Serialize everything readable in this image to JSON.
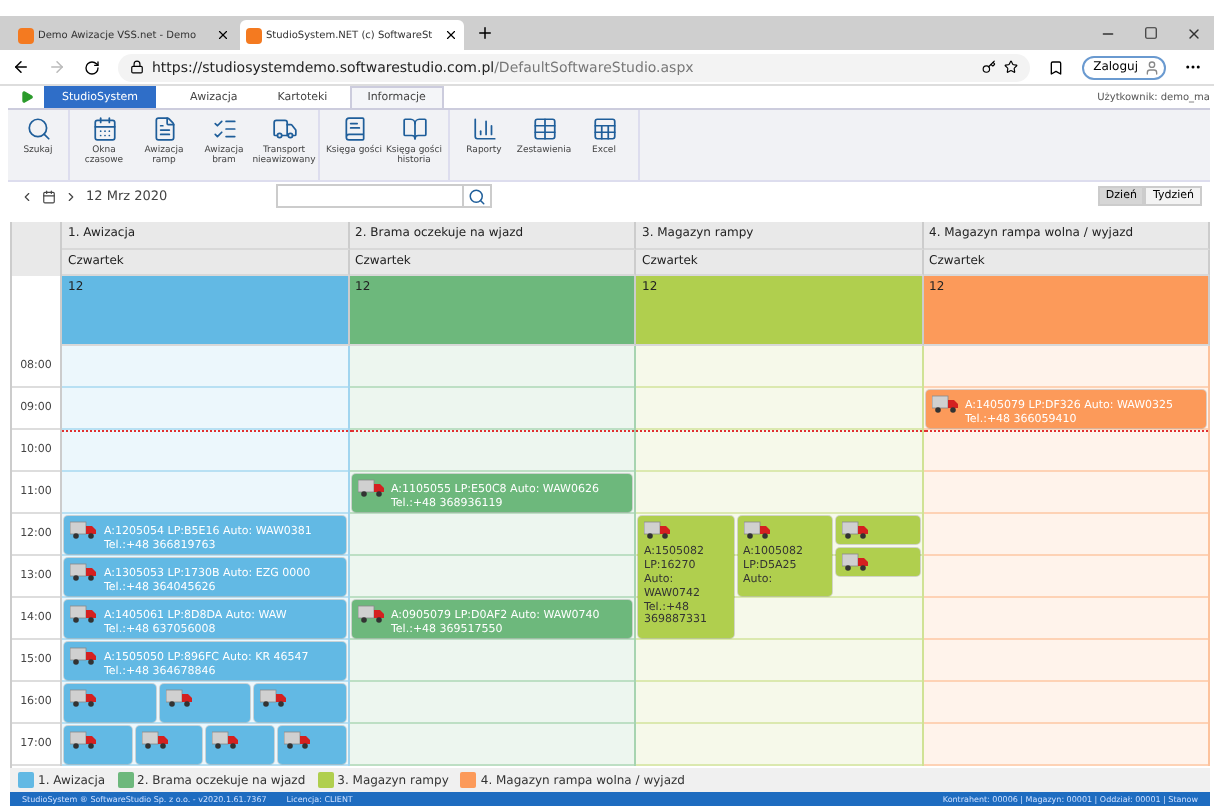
{
  "browser": {
    "tabs": [
      {
        "title": "Demo Awizacje VSS.net - Demo",
        "selected": false
      },
      {
        "title": "StudioSystem.NET (c) SoftwareSt",
        "selected": true
      }
    ],
    "url": {
      "host": "https://studiosystemdemo.softwarestudio.com.pl",
      "path": "/DefaultSoftwareStudio.aspx"
    },
    "profile_button": "Zaloguj"
  },
  "app": {
    "menu": [
      {
        "label": "StudioSystem",
        "kind": "app",
        "selected": false
      },
      {
        "label": "Awizacja",
        "kind": "tab",
        "selected": false
      },
      {
        "label": "Kartoteki",
        "kind": "tab",
        "selected": false
      },
      {
        "label": "Informacje",
        "kind": "tab",
        "selected": true
      }
    ],
    "user": "Użytkownik: demo_ma",
    "ribbon": [
      [
        "Szukaj"
      ],
      [
        "Okna czasowe",
        "Awizacja ramp",
        "Awizacja bram",
        "Transport nieawizowany"
      ],
      [
        "Księga gości",
        "Księga gości historia"
      ],
      [
        "Raporty",
        "Zestawienia",
        "Excel"
      ]
    ]
  },
  "date_nav": {
    "date": "12 Mrz 2020",
    "views": [
      {
        "label": "Dzień",
        "selected": true
      },
      {
        "label": "Tydzień",
        "selected": false
      }
    ]
  },
  "times": [
    {
      "label": "08:00",
      "now": false
    },
    {
      "label": "09:00",
      "now": false
    },
    {
      "label": "10:00",
      "now": true
    },
    {
      "label": "11:00",
      "now": false
    },
    {
      "label": "12:00",
      "now": false
    },
    {
      "label": "13:00",
      "now": false
    },
    {
      "label": "14:00",
      "now": false
    },
    {
      "label": "15:00",
      "now": false
    },
    {
      "label": "16:00",
      "now": false
    },
    {
      "label": "17:00",
      "now": false
    }
  ],
  "columns": [
    {
      "title": "1. Awizacja",
      "day": "Czwartek",
      "date": "12",
      "color": "#62b9e4",
      "cells": [
        {
          "kind": "free"
        },
        {
          "kind": "free"
        },
        {
          "kind": "free"
        },
        {
          "kind": "free"
        },
        {
          "kind": "booked",
          "lanes": [
            {
              "kind": "hour",
              "lines": [
                "A:1205054 LP:B5E16 Auto: WAW0381",
                "Tel.:+48 366819763"
              ]
            }
          ]
        },
        {
          "kind": "booked",
          "lanes": [
            {
              "kind": "hour",
              "lines": [
                "A:1305053 LP:1730B Auto: EZG 0000",
                "Tel.:+48 364045626"
              ]
            }
          ]
        },
        {
          "kind": "booked",
          "lanes": [
            {
              "kind": "hour",
              "lines": [
                "A:1405061 LP:8D8DA Auto: WAW",
                "Tel.:+48 637056008"
              ]
            }
          ]
        },
        {
          "kind": "booked",
          "lanes": [
            {
              "kind": "hour",
              "lines": [
                "A:1505050 LP:896FC Auto: KR 46547",
                "Tel.:+48 364678846"
              ]
            }
          ]
        },
        {
          "kind": "booked",
          "lanes": [
            {
              "kind": "hour"
            },
            {
              "kind": "hour"
            },
            {
              "kind": "hour"
            }
          ]
        },
        {
          "kind": "booked",
          "lanes": [
            {
              "kind": "hour"
            },
            {
              "kind": "hour"
            },
            {
              "kind": "hour"
            },
            {
              "kind": "hour"
            }
          ]
        }
      ]
    },
    {
      "title": "2. Brama oczekuje na wjazd",
      "day": "Czwartek",
      "date": "12",
      "color": "#6db87c",
      "cells": [
        {
          "kind": "free"
        },
        {
          "kind": "free"
        },
        {
          "kind": "free"
        },
        {
          "kind": "booked",
          "lanes": [
            {
              "kind": "hour",
              "lines": [
                "A:1105055 LP:E50C8 Auto: WAW0626",
                "Tel.:+48 368936119"
              ]
            }
          ]
        },
        {
          "kind": "free"
        },
        {
          "kind": "free"
        },
        {
          "kind": "booked",
          "lanes": [
            {
              "kind": "hour",
              "lines": [
                "A:0905079 LP:D0AF2 Auto: WAW0740",
                "Tel.:+48 369517550"
              ]
            }
          ]
        },
        {
          "kind": "free"
        },
        {
          "kind": "free"
        },
        {
          "kind": "free"
        }
      ]
    },
    {
      "title": "3. Magazyn rampy",
      "day": "Czwartek",
      "date": "12",
      "color": "#b0cf4e",
      "cells": [
        {
          "kind": "free"
        },
        {
          "kind": "free"
        },
        {
          "kind": "free"
        },
        {
          "kind": "free"
        },
        {
          "kind": "booked",
          "lanes": [
            {
              "kind": "three_hours",
              "lines": [
                "A:1505082 LP:16270 Auto: WAW0742 Tel.:+48 369887331"
              ]
            },
            {
              "kind": "two_hours",
              "lines": [
                "A:1005082 LP:D5A25 Auto:"
              ]
            },
            {
              "kind": "stack",
              "items": [
                {
                  "kind": "hour"
                },
                {
                  "kind": "hour"
                }
              ]
            }
          ]
        },
        {
          "kind": "free"
        },
        {
          "kind": "free"
        },
        {
          "kind": "free"
        },
        {
          "kind": "free"
        },
        {
          "kind": "free"
        }
      ]
    },
    {
      "title": "4. Magazyn rampa wolna / wyjazd",
      "day": "Czwartek",
      "date": "12",
      "color": "#fc9a5a",
      "cells": [
        {
          "kind": "free"
        },
        {
          "kind": "booked",
          "lanes": [
            {
              "kind": "hour",
              "lines": [
                "A:1405079 LP:DF326 Auto: WAW0325",
                "Tel.:+48 366059410"
              ]
            }
          ]
        },
        {
          "kind": "free"
        },
        {
          "kind": "free"
        },
        {
          "kind": "free"
        },
        {
          "kind": "free"
        },
        {
          "kind": "free"
        },
        {
          "kind": "free"
        },
        {
          "kind": "free"
        },
        {
          "kind": "free"
        }
      ]
    }
  ],
  "legend": [
    {
      "label": "1. Awizacja",
      "color": "#62b9e4"
    },
    {
      "label": "2. Brama oczekuje na wjazd",
      "color": "#6db87c"
    },
    {
      "label": "3. Magazyn rampy",
      "color": "#b0cf4e"
    },
    {
      "label": "4. Magazyn rampa wolna / wyjazd",
      "color": "#fc9a5a"
    }
  ],
  "status_bar": {
    "left": [
      "StudioSystem ® SoftwareStudio Sp. z o.o. - v2020.1.61.7367",
      "Licencja: CLIENT"
    ],
    "right": "Kontrahent: 00006 | Magazyn: 00001 | Oddział: 00001 | Stanow"
  }
}
